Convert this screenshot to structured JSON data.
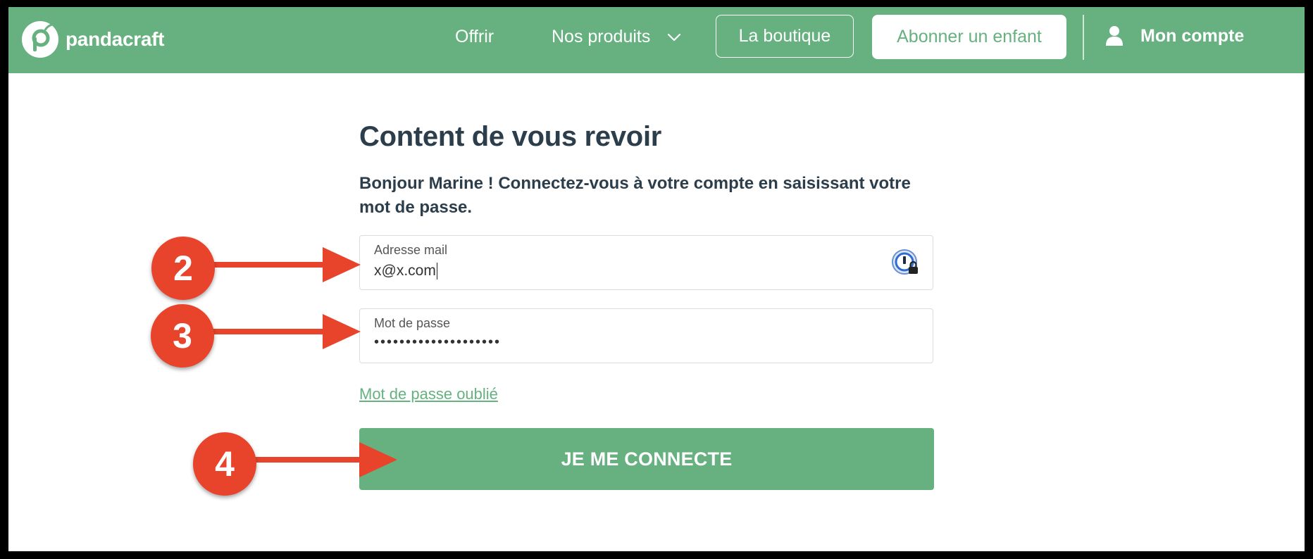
{
  "header": {
    "brand": "pandacraft",
    "nav": {
      "offrir": "Offrir",
      "produits": "Nos produits",
      "boutique": "La boutique",
      "abonner": "Abonner un enfant",
      "account": "Mon compte"
    }
  },
  "login": {
    "title": "Content de vous revoir",
    "subtitle": "Bonjour Marine ! Connectez-vous à votre compte en saisissant votre mot de passe.",
    "email": {
      "label": "Adresse mail",
      "value": "x@x.com"
    },
    "password": {
      "label": "Mot de passe",
      "value": "••••••••••••••••••••"
    },
    "forgot_link": "Mot de passe oublié",
    "submit": "JE ME CONNECTE"
  },
  "annotations": [
    "2",
    "3",
    "4"
  ],
  "colors": {
    "brand": "#66b17f",
    "annotation": "#e8432b",
    "text": "#2c3e4c"
  },
  "icons": [
    "pandacraft-logo-icon",
    "chevron-down-icon",
    "user-icon",
    "password-manager-icon"
  ]
}
